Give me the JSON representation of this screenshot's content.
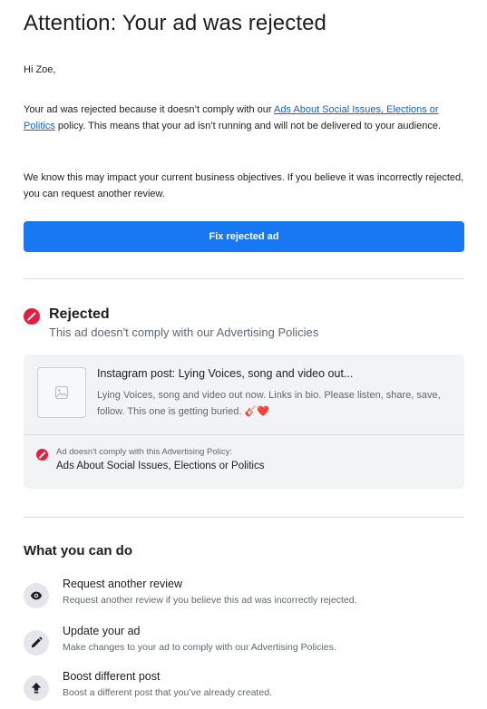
{
  "email": {
    "title": "Attention: Your ad was rejected",
    "greeting": "Hi Zoe,",
    "para1_before": "Your ad was rejected because it doesn’t comply with our ",
    "para1_link": "Ads About Social Issues, Elections or Politics",
    "para1_after": " policy. This means that your ad isn’t running and will not be delivered to your audience.",
    "para2": "We know this may impact your current business objectives. If you believe it was incorrectly rejected, you can request another review.",
    "fix_button": "Fix rejected ad"
  },
  "status": {
    "title": "Rejected",
    "subtitle": "This ad doesn't comply with our Advertising Policies"
  },
  "post": {
    "title": "Instagram post: Lying Voices, song and video out...",
    "body": "Lying Voices, song and video out now. Links in bio. Please listen, share, save, follow. This one is getting buried. ",
    "emoji": "🎸❤️",
    "policy_label": "Ad doesn't comply with this Advertising Policy:",
    "policy_name": "Ads About Social Issues, Elections or Politics"
  },
  "actions": {
    "heading": "What you can do",
    "items": [
      {
        "title": "Request another review",
        "desc": "Request another review if you believe this ad was incorrectly rejected.",
        "icon": "eye-icon"
      },
      {
        "title": "Update your ad",
        "desc": "Make changes to your ad to comply with our Advertising Policies.",
        "icon": "pencil-icon"
      },
      {
        "title": "Boost different post",
        "desc": "Boost a different post that you’ve already created.",
        "icon": "boost-arrow-icon"
      }
    ]
  },
  "colors": {
    "primary_button": "#1877f2",
    "link": "#1a5fd6",
    "rejected_red": "#e41e3f",
    "card_bg": "#f2f3f5"
  }
}
